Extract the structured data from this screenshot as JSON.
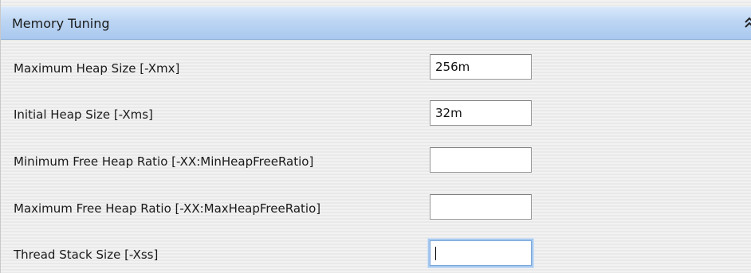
{
  "panel": {
    "title": "Memory Tuning",
    "collapse_icon": "chevron-up-icon"
  },
  "rows": [
    {
      "label": "Maximum Heap Size [-Xmx]",
      "value": "256m"
    },
    {
      "label": "Initial Heap Size [-Xms]",
      "value": "32m"
    },
    {
      "label": "Minimum Free Heap Ratio [-XX:MinHeapFreeRatio]",
      "value": ""
    },
    {
      "label": "Maximum Free Heap Ratio [-XX:MaxHeapFreeRatio]",
      "value": ""
    },
    {
      "label": "Thread Stack Size [-Xss]",
      "value": ""
    }
  ],
  "colors": {
    "header_gradient_top": "#d9e8fb",
    "header_gradient_bottom": "#a9c8ef",
    "focus_ring": "#a8c9ee"
  }
}
